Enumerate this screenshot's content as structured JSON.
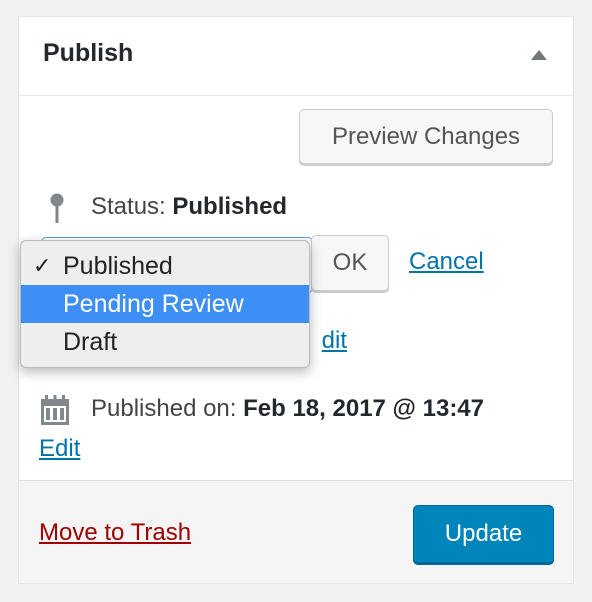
{
  "header": {
    "title": "Publish"
  },
  "actions": {
    "preview_label": "Preview Changes",
    "ok_label": "OK",
    "cancel_label": "Cancel",
    "trash_label": "Move to Trash",
    "update_label": "Update"
  },
  "status": {
    "label": "Status:",
    "value": "Published"
  },
  "visibility": {
    "edit_partial": "dit"
  },
  "published_on": {
    "label": "Published on:",
    "value": "Feb 18, 2017 @ 13:47",
    "edit_label": "Edit"
  },
  "dropdown": {
    "checkmark": "✓",
    "options": [
      {
        "label": "Published",
        "selected": true
      },
      {
        "label": "Pending Review",
        "highlighted": true
      },
      {
        "label": "Draft"
      }
    ]
  },
  "colors": {
    "link": "#0073aa",
    "trash": "#a00000",
    "primary_button": "#0085ba",
    "highlight": "#3d8ef5"
  },
  "icons": {
    "toggle": "triangle-up-icon",
    "status": "pin-icon",
    "date": "calendar-icon"
  }
}
